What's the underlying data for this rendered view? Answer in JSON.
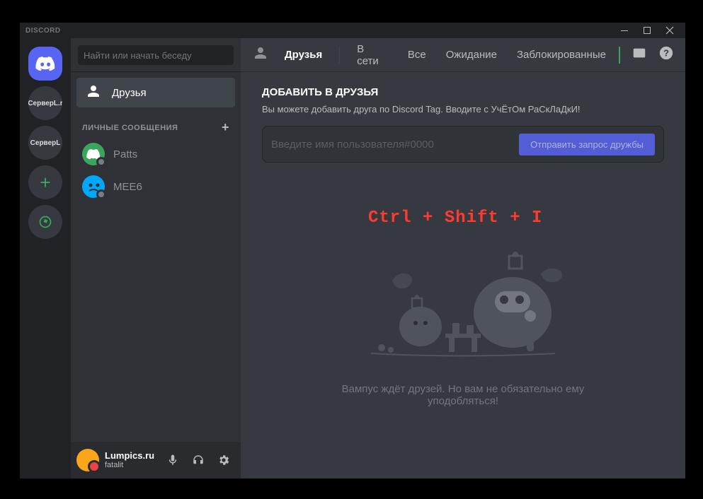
{
  "titlebar": {
    "title": "DISCORD"
  },
  "servers": {
    "server1": "СерверL.r",
    "server2": "СерверL"
  },
  "search": {
    "placeholder": "Найти или начать беседу"
  },
  "friends_label": "Друзья",
  "dm_header": "ЛИЧНЫЕ СООБЩЕНИЯ",
  "dms": [
    {
      "name": "Patts"
    },
    {
      "name": "MEE6"
    }
  ],
  "user": {
    "name": "Lumpics.ru",
    "status": "fatalit"
  },
  "topbar": {
    "friends": "Друзья",
    "online": "В сети",
    "all": "Все",
    "pending": "Ожидание",
    "blocked": "Заблокированные"
  },
  "add_friend": {
    "title": "ДОБАВИТЬ В ДРУЗЬЯ",
    "desc": "Вы можете добавить друга по Discord Tag. Вводите с УчЁтОм РаСкЛаДкИ!",
    "placeholder": "Введите имя пользователя#0000",
    "button": "Отправить запрос дружбы"
  },
  "hotkey": "Ctrl + Shift + I",
  "wumpus_text": "Вампус ждёт друзей. Но вам не обязательно ему уподобляться!"
}
